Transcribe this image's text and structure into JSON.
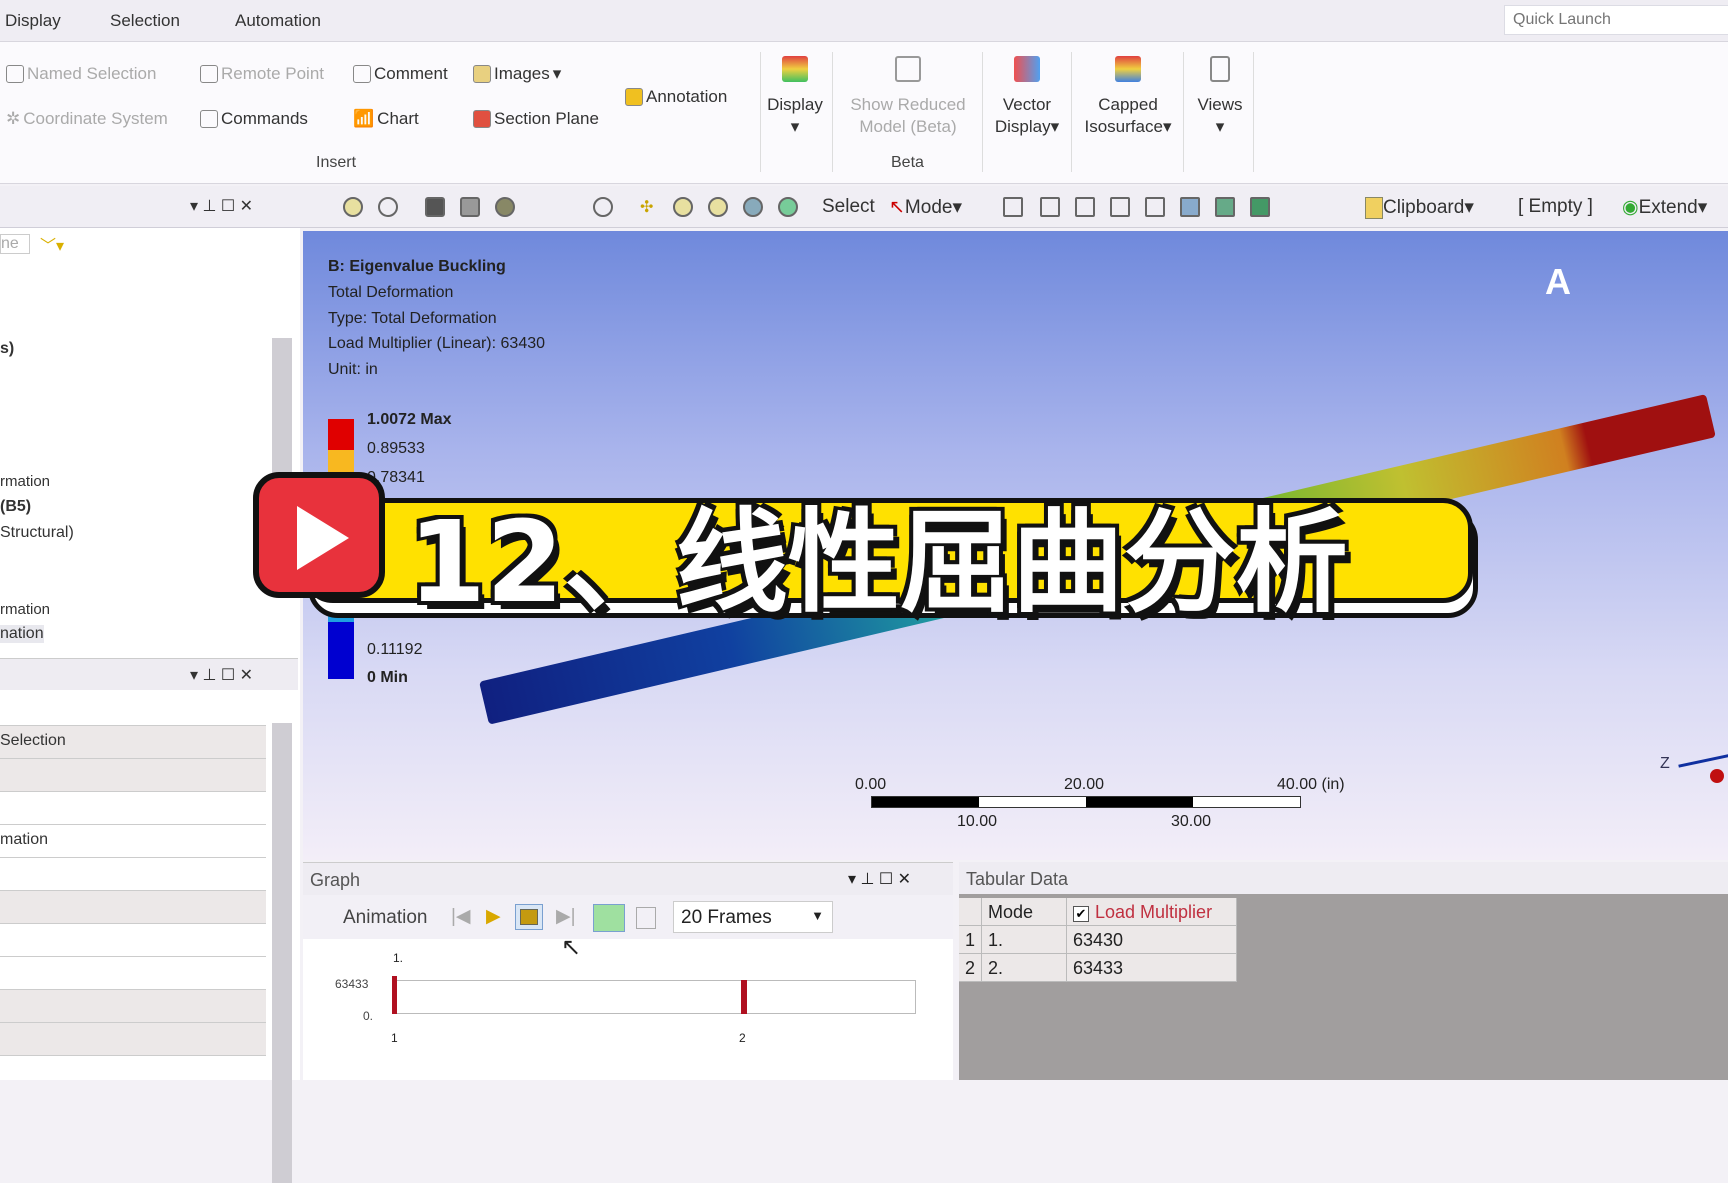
{
  "menu": [
    "Display",
    "Selection",
    "Automation"
  ],
  "quick_launch": {
    "placeholder": "Quick Launch"
  },
  "ribbon": {
    "insert": {
      "named_selection": "Named Selection",
      "remote_point": "Remote Point",
      "comment": "Comment",
      "images": "Images",
      "coordinate_system": "Coordinate System",
      "commands": "Commands",
      "chart": "Chart",
      "section_plane": "Section Plane",
      "annotation": "Annotation",
      "group": "Insert"
    },
    "display": "Display",
    "show_reduced": "Show Reduced",
    "show_reduced2": "Model (Beta)",
    "beta_group": "Beta",
    "vector1": "Vector",
    "vector2": "Display",
    "capped1": "Capped",
    "capped2": "Isosurface",
    "views": "Views"
  },
  "toolbar": {
    "select": "Select",
    "mode": "Mode",
    "clipboard": "Clipboard",
    "empty": "[ Empty ]",
    "extend": "Extend"
  },
  "left": {
    "filter_text": "ne",
    "tree": [
      "s)",
      "rmation",
      "(B5)",
      "Structural)",
      "rmation",
      "nation"
    ],
    "details": [
      "Selection",
      "mation"
    ]
  },
  "viewport": {
    "title": "B: Eigenvalue Buckling",
    "lines": [
      "Total Deformation",
      "Type: Total Deformation",
      "Load Multiplier (Linear): 63430",
      "Unit: in"
    ],
    "legend": [
      "1.0072 Max",
      "0.89533",
      "0.78341",
      "0.11192",
      "0 Min"
    ],
    "legend_colors": [
      "#e00000",
      "#f8b820",
      "#0000d0"
    ],
    "scale": [
      "0.00",
      "20.00",
      "40.00 (in)",
      "10.00",
      "30.00"
    ],
    "axis": "Z",
    "corner": "A"
  },
  "graph": {
    "title": "Graph",
    "animation": "Animation",
    "frames": "20 Frames",
    "y_ticks": [
      "63433",
      "0."
    ],
    "x_ticks": [
      "1",
      "2"
    ],
    "top_label": "1."
  },
  "tabular": {
    "title": "Tabular Data",
    "headers": [
      "Mode",
      "Load Multiplier"
    ],
    "rows": [
      [
        "1",
        "1.",
        "63430"
      ],
      [
        "2",
        "2.",
        "63433"
      ]
    ]
  },
  "banner": {
    "text": "12、线性屈曲分析",
    "play_color": "#e8323c",
    "bg": "#ffe100"
  }
}
